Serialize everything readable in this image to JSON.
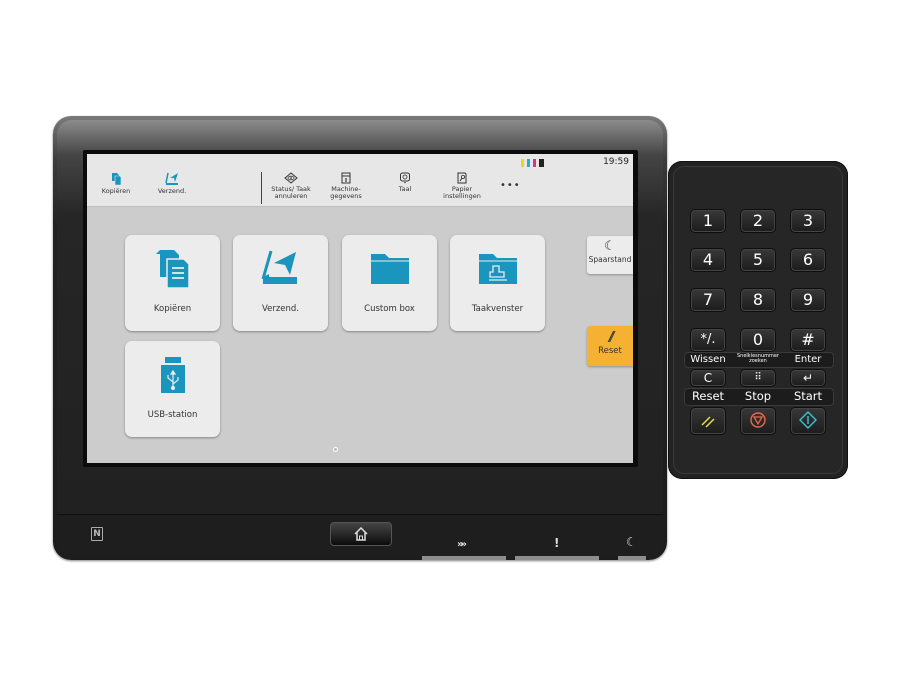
{
  "status_bar": {
    "time": "19:59",
    "toner": [
      {
        "name": "yellow",
        "color": "#f2d41b"
      },
      {
        "name": "cyan",
        "color": "#2aa8d8"
      },
      {
        "name": "magenta",
        "color": "#d6357f"
      },
      {
        "name": "black",
        "color": "#222222"
      }
    ]
  },
  "quick_bar": {
    "items": [
      {
        "label": "Kopiëren",
        "icon": "copy-icon"
      },
      {
        "label": "Verzend.",
        "icon": "send-icon"
      },
      {
        "label": "Status/ Taak annuleren",
        "icon": "status-eye-icon"
      },
      {
        "label": "Machine-gegevens",
        "icon": "machine-info-icon"
      },
      {
        "label": "Taal",
        "icon": "language-icon"
      },
      {
        "label": "Papier instellingen",
        "icon": "paper-settings-icon"
      }
    ],
    "more_label": "•••"
  },
  "home": {
    "tiles": [
      {
        "label": "Kopiëren",
        "icon": "copy-icon"
      },
      {
        "label": "Verzend.",
        "icon": "send-icon"
      },
      {
        "label": "Custom box",
        "icon": "folder-icon"
      },
      {
        "label": "Taakvenster",
        "icon": "job-box-icon"
      },
      {
        "label": "USB-station",
        "icon": "usb-icon"
      }
    ],
    "accent_color": "#1a95bd"
  },
  "side": {
    "energy_saver_label": "Spaarstand",
    "reset_label": "Reset",
    "reset_color": "#f5b131"
  },
  "keypad": {
    "digits": [
      "1",
      "2",
      "3",
      "4",
      "5",
      "6",
      "7",
      "8",
      "9"
    ],
    "row4": [
      "*/.",
      "0",
      "#"
    ],
    "labels1": [
      "Wissen",
      "Snelkiesnummer zoeken",
      "Enter"
    ],
    "labels2": [
      "Reset",
      "Stop",
      "Start"
    ],
    "clear_key": "C",
    "quick_num_key": "⠿",
    "enter_key": "↵"
  }
}
